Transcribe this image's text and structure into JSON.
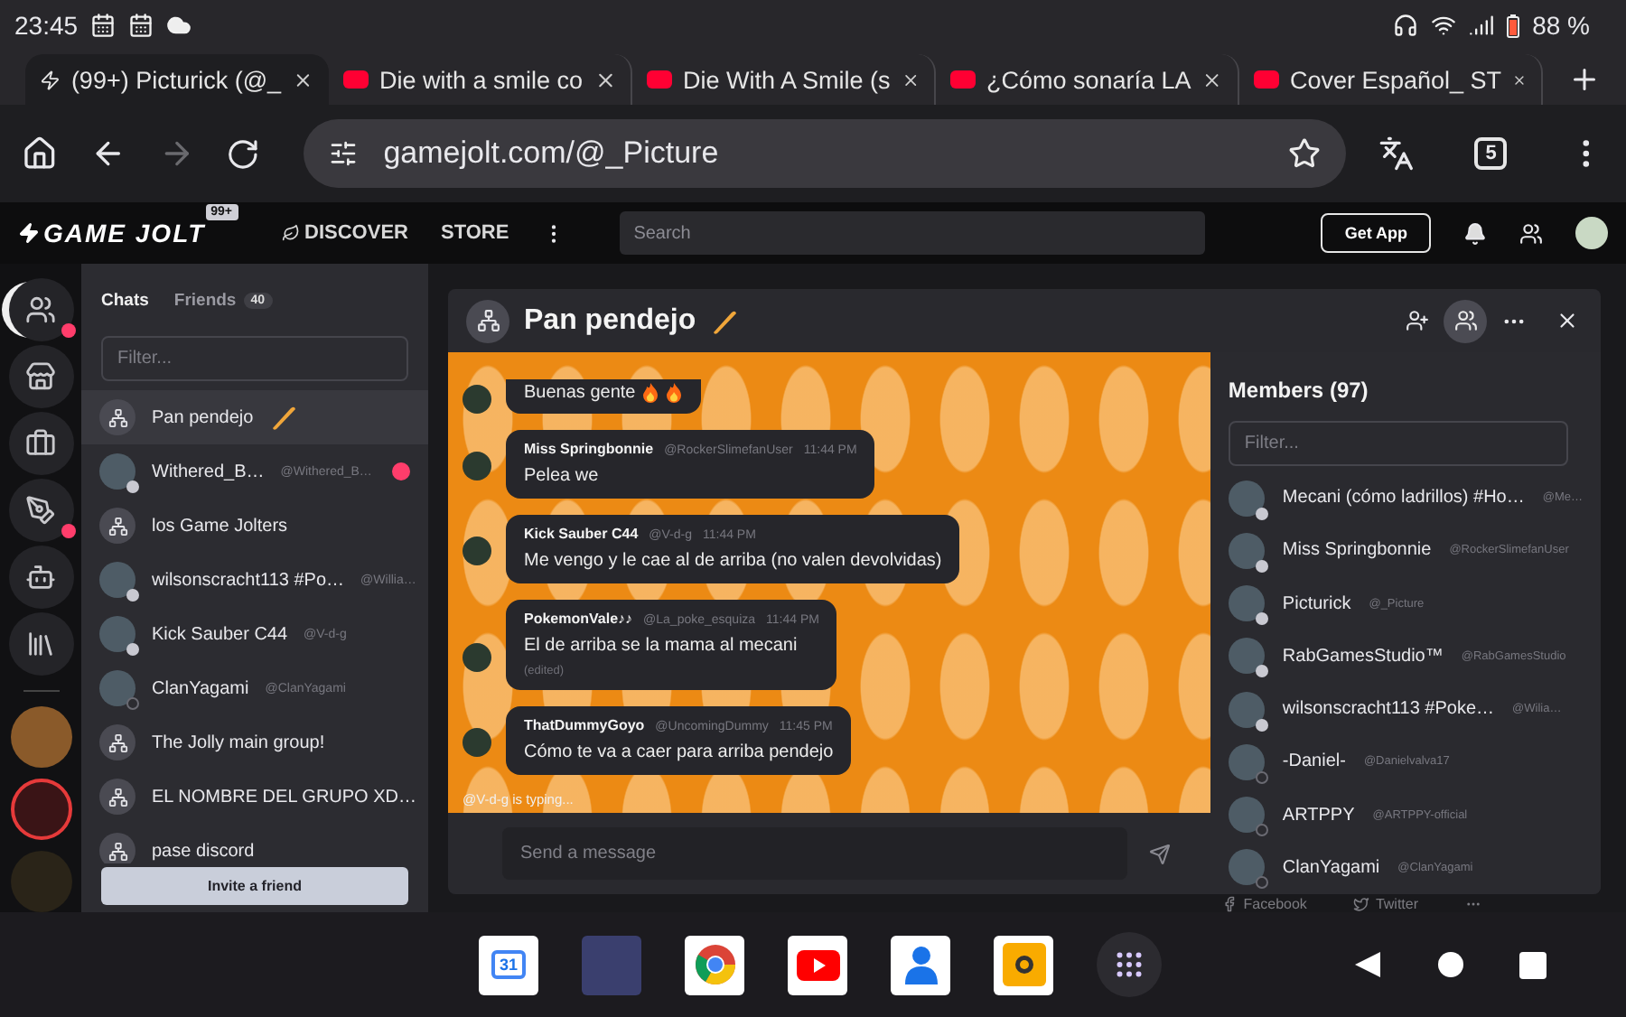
{
  "status_bar": {
    "time": "23:45",
    "battery": "88 %"
  },
  "browser_tabs": [
    {
      "title": "(99+) Picturick (@_",
      "kind": "gamejolt",
      "selected": true
    },
    {
      "title": "Die with a smile co",
      "kind": "youtube",
      "selected": false
    },
    {
      "title": "Die With A Smile (s",
      "kind": "youtube",
      "selected": false
    },
    {
      "title": "¿Cómo sonaría LA",
      "kind": "youtube",
      "selected": false
    },
    {
      "title": "Cover Español_ ST",
      "kind": "youtube",
      "selected": false
    }
  ],
  "address_bar": {
    "url": "gamejolt.com/@_Picture",
    "tab_count": "5"
  },
  "site_header": {
    "logo": "GAME JOLT",
    "badge": "99+",
    "nav": [
      "DISCOVER",
      "STORE"
    ],
    "search": {
      "placeholder": "Search"
    },
    "get_app": "Get App"
  },
  "rail": {
    "items": [
      {
        "kind": "chat",
        "selected": true,
        "notification": true
      },
      {
        "kind": "store",
        "selected": false,
        "notification": false
      },
      {
        "kind": "bag",
        "selected": false,
        "notification": false
      },
      {
        "kind": "forum",
        "selected": false,
        "notification": true
      },
      {
        "kind": "bot",
        "selected": false,
        "notification": false
      },
      {
        "kind": "library",
        "selected": false,
        "notification": false
      }
    ]
  },
  "chat_list": {
    "tabs": [
      {
        "label": "Chats",
        "selected": true
      },
      {
        "label": "Friends",
        "count": "40",
        "selected": false
      }
    ],
    "filter": {
      "placeholder": "Filter..."
    },
    "items": [
      {
        "name": "Pan pendejo",
        "kind": "group",
        "emblem": true,
        "selected": true,
        "unread": false
      },
      {
        "name": "Withered_B…",
        "handle": "@Withered_B…",
        "kind": "user",
        "online": true,
        "selected": false,
        "unread": true
      },
      {
        "name": "los Game Jolters",
        "kind": "group",
        "selected": false,
        "unread": false
      },
      {
        "name": "wilsonscracht113 #Po…",
        "handle": "@Willia…",
        "kind": "user",
        "online": true,
        "selected": false,
        "unread": false
      },
      {
        "name": "Kick Sauber C44",
        "handle": "@V-d-g",
        "kind": "user",
        "online": true,
        "selected": false,
        "unread": false
      },
      {
        "name": "ClanYagami",
        "handle": "@ClanYagami",
        "kind": "user",
        "online": false,
        "selected": false,
        "unread": false
      },
      {
        "name": "The Jolly main group!",
        "kind": "group",
        "selected": false,
        "unread": false
      },
      {
        "name": "EL NOMBRE DEL GRUPO XD…",
        "kind": "group",
        "selected": false,
        "unread": false
      },
      {
        "name": "pase discord",
        "kind": "group",
        "selected": false,
        "unread": false
      }
    ],
    "invite_button": "Invite a friend"
  },
  "chat": {
    "title": "Pan pendejo",
    "emblem": true,
    "messages": [
      {
        "kind": "continuation",
        "text": "Buenas gente",
        "fire_emoji": true
      },
      {
        "kind": "full",
        "author": "Miss Springbonnie",
        "handle": "@RockerSlimefanUser",
        "time": "11:44 PM",
        "text": "Pelea we"
      },
      {
        "kind": "full",
        "author": "Kick Sauber C44",
        "handle": "@V-d-g",
        "time": "11:44 PM",
        "text": "Me vengo y le cae al de arriba (no valen devolvidas)"
      },
      {
        "kind": "full",
        "author": "PokemonVale♪♪",
        "handle": "@La_poke_esquiza",
        "time": "11:44 PM",
        "text": "El de arriba se la mama al mecani",
        "edited": "(edited)"
      },
      {
        "kind": "full",
        "author": "ThatDummyGoyo",
        "handle": "@UncomingDummy",
        "time": "11:45 PM",
        "text": "Cómo te va a caer para arriba pendejo"
      }
    ],
    "typing": "@V-d-g is typing...",
    "input": {
      "placeholder": "Send a message"
    }
  },
  "members": {
    "title": "Members (97)",
    "filter": {
      "placeholder": "Filter..."
    },
    "items": [
      {
        "name": "Mecani (cómo ladrillos) #Ho…",
        "handle": "@Me…",
        "online": true
      },
      {
        "name": "Miss Springbonnie",
        "handle": "@RockerSlimefanUser",
        "online": true
      },
      {
        "name": "Picturick",
        "handle": "@_Picture",
        "online": true
      },
      {
        "name": "RabGamesStudio™",
        "handle": "@RabGamesStudio",
        "online": true
      },
      {
        "name": "wilsonscracht113 #Poke…",
        "handle": "@Wilia…",
        "online": true
      },
      {
        "name": "-Daniel-",
        "handle": "@Danielvalva17",
        "online": false
      },
      {
        "name": "ARTPPY",
        "handle": "@ARTPPY-official",
        "online": false
      },
      {
        "name": "ClanYagami",
        "handle": "@ClanYagami",
        "online": false
      }
    ]
  },
  "footer_links": [
    {
      "label": "Facebook",
      "kind": "facebook"
    },
    {
      "label": "Twitter",
      "kind": "twitter"
    }
  ],
  "dock": {
    "calendar_day": "31"
  }
}
